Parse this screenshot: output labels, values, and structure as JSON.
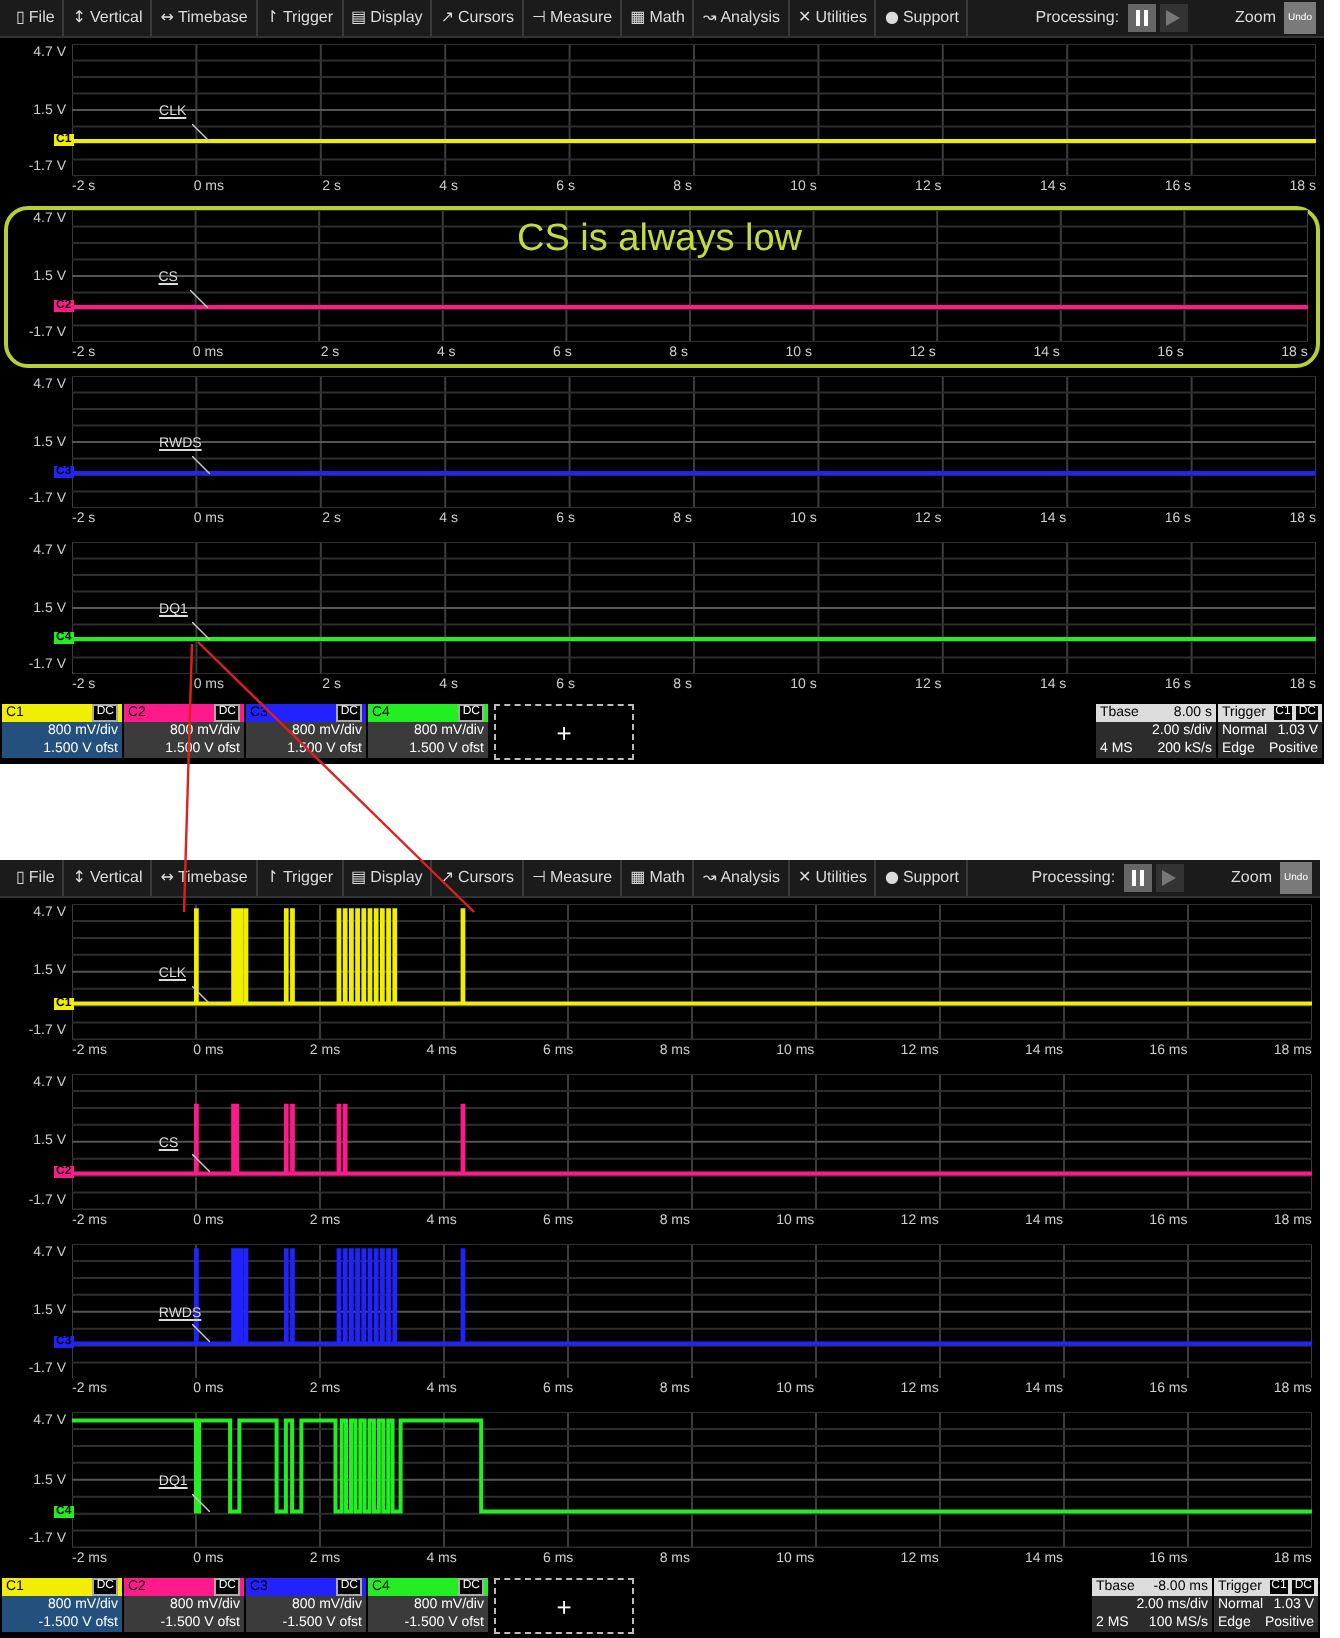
{
  "screens": [
    {
      "menu": [
        {
          "icon": "▯",
          "label": "File"
        },
        {
          "icon": "↕",
          "label": "Vertical"
        },
        {
          "icon": "↔",
          "label": "Timebase"
        },
        {
          "icon": "↾",
          "label": "Trigger"
        },
        {
          "icon": "▤",
          "label": "Display"
        },
        {
          "icon": "↗",
          "label": "Cursors"
        },
        {
          "icon": "⊣",
          "label": "Measure"
        },
        {
          "icon": "▦",
          "label": "Math"
        },
        {
          "icon": "↝",
          "label": "Analysis"
        },
        {
          "icon": "✕",
          "label": "Utilities"
        },
        {
          "icon": "●",
          "label": "Support"
        }
      ],
      "processing": "Processing:",
      "zoom": "Zoom",
      "undo": "Undo",
      "channels": [
        {
          "name": "CLK",
          "marker": "C1",
          "color": "#f2ee00",
          "kind": "flat",
          "y_labels": [
            "4.7 V",
            "1.5 V",
            "-1.7 V"
          ],
          "x_labels": [
            "-2 s",
            "0 ms",
            "2 s",
            "4 s",
            "6 s",
            "8 s",
            "10 s",
            "12 s",
            "14 s",
            "16 s",
            "18 s"
          ]
        },
        {
          "name": "CS",
          "marker": "C2",
          "color": "#ff1a8c",
          "kind": "flat",
          "callout": "CS is always low",
          "y_labels": [
            "4.7 V",
            "1.5 V",
            "-1.7 V"
          ],
          "x_labels": [
            "-2 s",
            "0 ms",
            "2 s",
            "4 s",
            "6 s",
            "8 s",
            "10 s",
            "12 s",
            "14 s",
            "16 s",
            "18 s"
          ]
        },
        {
          "name": "RWDS",
          "marker": "C3",
          "color": "#2222ff",
          "kind": "flat",
          "y_labels": [
            "4.7 V",
            "1.5 V",
            "-1.7 V"
          ],
          "x_labels": [
            "-2 s",
            "0 ms",
            "2 s",
            "4 s",
            "6 s",
            "8 s",
            "10 s",
            "12 s",
            "14 s",
            "16 s",
            "18 s"
          ]
        },
        {
          "name": "DQ1",
          "marker": "C4",
          "color": "#22ee22",
          "kind": "flat",
          "y_labels": [
            "4.7 V",
            "1.5 V",
            "-1.7 V"
          ],
          "x_labels": [
            "-2 s",
            "0 ms",
            "2 s",
            "4 s",
            "6 s",
            "8 s",
            "10 s",
            "12 s",
            "14 s",
            "16 s",
            "18 s"
          ]
        }
      ],
      "descriptors": [
        {
          "label": "C1",
          "coupling": "DC",
          "scale": "800 mV/div",
          "offset": "1.500 V ofst",
          "color": "#f2ee00",
          "selected": true
        },
        {
          "label": "C2",
          "coupling": "DC",
          "scale": "800 mV/div",
          "offset": "1.500 V ofst",
          "color": "#ff1a8c",
          "selected": false
        },
        {
          "label": "C3",
          "coupling": "DC",
          "scale": "800 mV/div",
          "offset": "1.500 V ofst",
          "color": "#2222ff",
          "selected": false
        },
        {
          "label": "C4",
          "coupling": "DC",
          "scale": "800 mV/div",
          "offset": "1.500 V ofst",
          "color": "#22ee22",
          "selected": false
        }
      ],
      "add_button": "+",
      "timebase": {
        "label": "Tbase",
        "delay": "8.00 s",
        "scale": "2.00 s/div",
        "samples": "4 MS",
        "rate": "200 kS/s"
      },
      "trigger": {
        "label": "Trigger",
        "source": "C1",
        "coupling": "DC",
        "mode": "Normal",
        "threshold": "1.03 V",
        "type": "Edge",
        "slope": "Positive"
      }
    },
    {
      "menu": [
        {
          "icon": "▯",
          "label": "File"
        },
        {
          "icon": "↕",
          "label": "Vertical"
        },
        {
          "icon": "↔",
          "label": "Timebase"
        },
        {
          "icon": "↾",
          "label": "Trigger"
        },
        {
          "icon": "▤",
          "label": "Display"
        },
        {
          "icon": "↗",
          "label": "Cursors"
        },
        {
          "icon": "⊣",
          "label": "Measure"
        },
        {
          "icon": "▦",
          "label": "Math"
        },
        {
          "icon": "↝",
          "label": "Analysis"
        },
        {
          "icon": "✕",
          "label": "Utilities"
        },
        {
          "icon": "●",
          "label": "Support"
        }
      ],
      "processing": "Processing:",
      "zoom": "Zoom",
      "undo": "Undo",
      "channels": [
        {
          "name": "CLK",
          "marker": "C1",
          "color": "#f2ee00",
          "kind": "clock-burst",
          "y_labels": [
            "4.7 V",
            "1.5 V",
            "-1.7 V"
          ],
          "x_labels": [
            "-2 ms",
            "0 ms",
            "2 ms",
            "4 ms",
            "6 ms",
            "8 ms",
            "10 ms",
            "12 ms",
            "14 ms",
            "16 ms",
            "18 ms"
          ]
        },
        {
          "name": "CS",
          "marker": "C2",
          "color": "#ff1a8c",
          "kind": "select-burst",
          "y_labels": [
            "4.7 V",
            "1.5 V",
            "-1.7 V"
          ],
          "x_labels": [
            "-2 ms",
            "0 ms",
            "2 ms",
            "4 ms",
            "6 ms",
            "8 ms",
            "10 ms",
            "12 ms",
            "14 ms",
            "16 ms",
            "18 ms"
          ]
        },
        {
          "name": "RWDS",
          "marker": "C3",
          "color": "#2222ff",
          "kind": "clock-burst",
          "y_labels": [
            "4.7 V",
            "1.5 V",
            "-1.7 V"
          ],
          "x_labels": [
            "-2 ms",
            "0 ms",
            "2 ms",
            "4 ms",
            "6 ms",
            "8 ms",
            "10 ms",
            "12 ms",
            "14 ms",
            "16 ms",
            "18 ms"
          ]
        },
        {
          "name": "DQ1",
          "marker": "C4",
          "color": "#22ee22",
          "kind": "data-burst",
          "y_labels": [
            "4.7 V",
            "1.5 V",
            "-1.7 V"
          ],
          "x_labels": [
            "-2 ms",
            "0 ms",
            "2 ms",
            "4 ms",
            "6 ms",
            "8 ms",
            "10 ms",
            "12 ms",
            "14 ms",
            "16 ms",
            "18 ms"
          ]
        }
      ],
      "descriptors": [
        {
          "label": "C1",
          "coupling": "DC",
          "scale": "800 mV/div",
          "offset": "-1.500 V ofst",
          "color": "#f2ee00",
          "selected": true
        },
        {
          "label": "C2",
          "coupling": "DC",
          "scale": "800 mV/div",
          "offset": "-1.500 V ofst",
          "color": "#ff1a8c",
          "selected": false
        },
        {
          "label": "C3",
          "coupling": "DC",
          "scale": "800 mV/div",
          "offset": "-1.500 V ofst",
          "color": "#2222ff",
          "selected": false
        },
        {
          "label": "C4",
          "coupling": "DC",
          "scale": "800 mV/div",
          "offset": "-1.500 V ofst",
          "color": "#22ee22",
          "selected": false
        }
      ],
      "add_button": "+",
      "timebase": {
        "label": "Tbase",
        "delay": "-8.00 ms",
        "scale": "2.00 ms/div",
        "samples": "2 MS",
        "rate": "100 MS/s"
      },
      "trigger": {
        "label": "Trigger",
        "source": "C1",
        "coupling": "DC",
        "mode": "Normal",
        "threshold": "1.03 V",
        "type": "Edge",
        "slope": "Positive"
      }
    }
  ]
}
